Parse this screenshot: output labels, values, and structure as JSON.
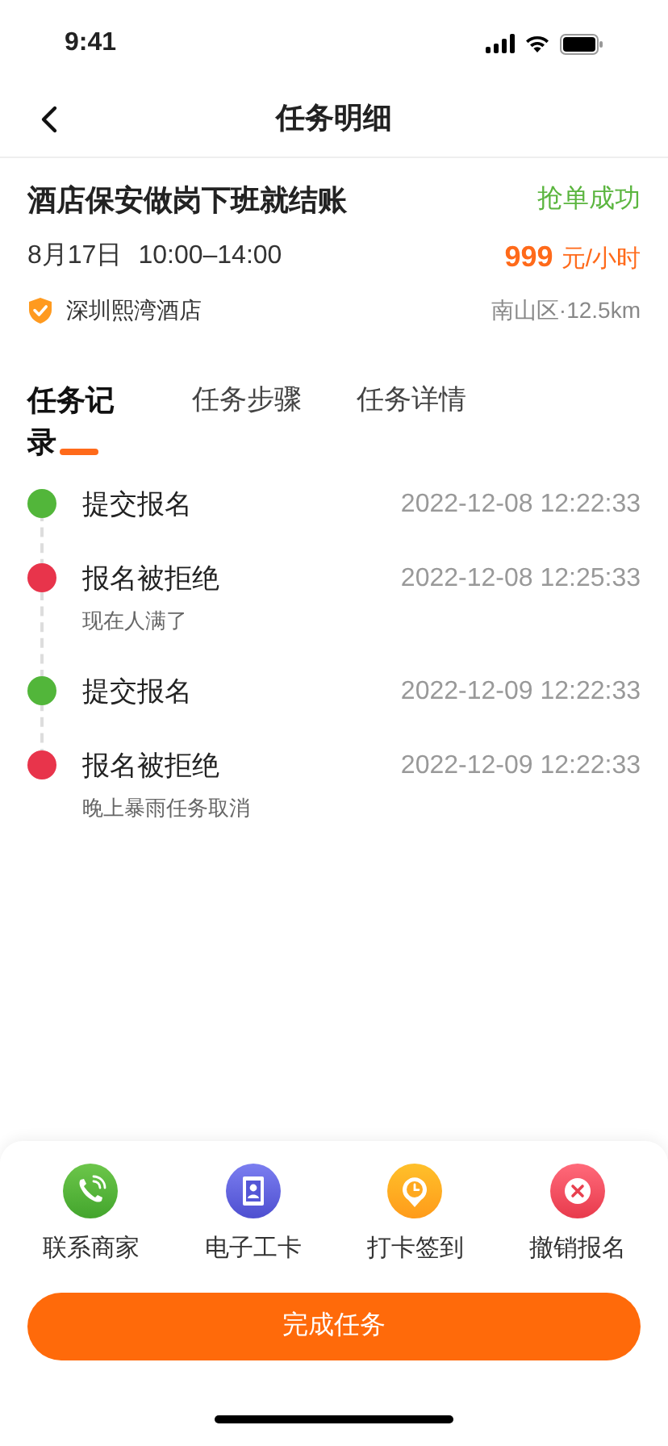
{
  "status_bar": {
    "time": "9:41"
  },
  "nav": {
    "title": "任务明细"
  },
  "task": {
    "title": "酒店保安做岗下班就结账",
    "status": "抢单成功",
    "date": "8月17日",
    "hours": "10:00–14:00",
    "price": "999",
    "unit": "元/小时",
    "merchant": "深圳熙湾酒店",
    "location": "南山区·12.5km"
  },
  "tabs": [
    {
      "label": "任务记录",
      "selected": true
    },
    {
      "label": "任务步骤",
      "selected": false
    },
    {
      "label": "任务详情",
      "selected": false
    }
  ],
  "records": [
    {
      "title": "提交报名",
      "time": "2022-12-08 12:22:33",
      "color": "#52b63a"
    },
    {
      "title": "报名被拒绝",
      "time": "2022-12-08 12:25:33",
      "note": "现在人满了",
      "color": "#e8344b"
    },
    {
      "title": "提交报名",
      "time": "2022-12-09 12:22:33",
      "color": "#52b63a"
    },
    {
      "title": "报名被拒绝",
      "time": "2022-12-09 12:22:33",
      "note": "晚上暴雨任务取消",
      "color": "#e8344b"
    }
  ],
  "actions": [
    {
      "kind": "phone",
      "label": "联系商家"
    },
    {
      "kind": "badge",
      "label": "电子工卡"
    },
    {
      "kind": "clock",
      "label": "打卡签到"
    },
    {
      "kind": "cancel",
      "label": "撤销报名"
    }
  ],
  "primary_button": "完成任务"
}
